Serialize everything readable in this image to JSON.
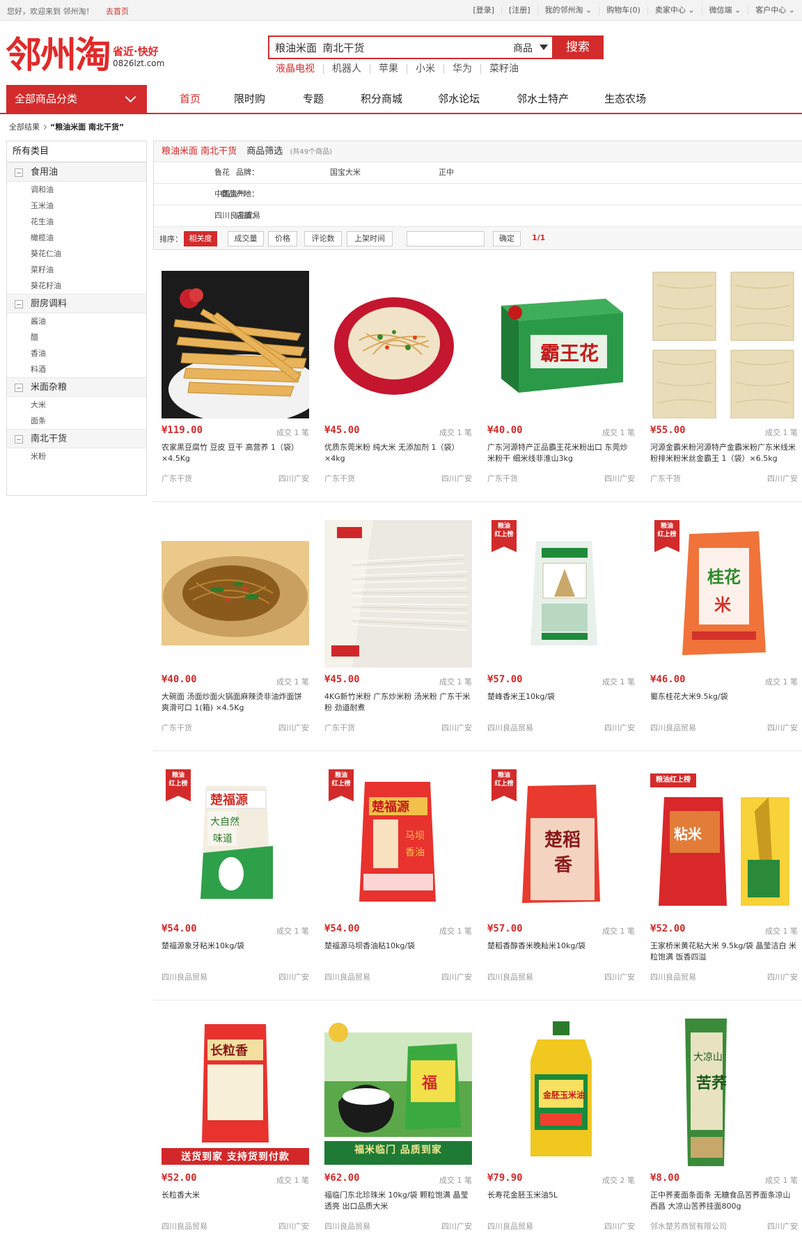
{
  "topbar": {
    "welcome": "您好，欢迎来到 邻州淘！",
    "home_link": "去首页",
    "links": [
      "[登录]",
      "[注册]",
      "我的邻州淘 ⌄",
      "购物车(0)",
      "卖家中心 ⌄",
      "微信端 ⌄",
      "客户中心 ⌄"
    ]
  },
  "logo": {
    "name": "邻州淘",
    "slogan": "省近·快好",
    "domain": "0826lzt.com"
  },
  "search": {
    "value": "粮油米面  南北干货",
    "category": "商品",
    "button": "搜索"
  },
  "hot_words": [
    "液晶电视",
    "机器人",
    "苹果",
    "小米",
    "华为",
    "菜籽油"
  ],
  "nav": {
    "category_button": "全部商品分类",
    "items": [
      "首页",
      "限时购",
      "专题",
      "积分商城",
      "邻水论坛",
      "邻水土特产",
      "生态农场"
    ]
  },
  "breadcrumb": {
    "root": "全部结果",
    "current": "“粮油米面  南北干货”"
  },
  "sidebar": {
    "title": "所有类目",
    "groups": [
      {
        "name": "食用油",
        "items": [
          "调和油",
          "玉米油",
          "花生油",
          "橄榄油",
          "葵花仁油",
          "菜籽油",
          "葵花籽油"
        ]
      },
      {
        "name": "厨房调料",
        "items": [
          "酱油",
          "醋",
          "香油",
          "料酒"
        ]
      },
      {
        "name": "米面杂粮",
        "items": [
          "大米",
          "面条"
        ]
      },
      {
        "name": "南北干货",
        "items": [
          "米粉"
        ]
      }
    ]
  },
  "filter": {
    "keyword": "粮油米面 南北干货",
    "label": "商品筛选",
    "count": "(共49个商品)",
    "brand_key": "品牌：",
    "brands": [
      "鲁花",
      "国宝大米",
      "正中"
    ],
    "origin_key": "商品产地：",
    "origin": "中国贵州",
    "shop_key": "店铺：",
    "shop": "四川良品贸易",
    "sort_label": "排序：",
    "sorts": [
      "相关度",
      "成交量",
      "价格",
      "评论数",
      "上架时间"
    ],
    "confirm": "确定",
    "page": "1/1"
  },
  "colors": {
    "accent": "#d32b2b",
    "muted": "#999999"
  },
  "products": [
    {
      "price": "¥119.00",
      "sold": "成交 1 笔",
      "title": "农家黑豆腐竹 豆皮 豆干 高营养 1（袋）×4.5Kg",
      "shop": "广东干货",
      "loc": "四川广安",
      "img": "yuba",
      "badge": ""
    },
    {
      "price": "¥45.00",
      "sold": "成交 1 笔",
      "title": "优质东莞米粉 纯大米 无添加剂 1（袋）×4kg",
      "shop": "广东干货",
      "loc": "四川广安",
      "img": "noodle-plate",
      "badge": ""
    },
    {
      "price": "¥40.00",
      "sold": "成交 1 笔",
      "title": "广东河源特产正品霸王花米粉出口 东莞炒米粉干 细米线非淮山3kg",
      "shop": "广东干货",
      "loc": "四川广安",
      "img": "green-box",
      "badge": ""
    },
    {
      "price": "¥55.00",
      "sold": "成交 1 笔",
      "title": "河源金霸米粉河源特产金霸米粉广东米线米粉排米粉米丝金霸王 1（袋）×6.5kg",
      "shop": "广东干货",
      "loc": "四川广安",
      "img": "noodle-cakes",
      "badge": ""
    },
    {
      "price": "¥40.00",
      "sold": "成交 1 笔",
      "title": "大碗面 汤面炒面火锅面麻辣烫非油炸面饼 爽滑可口 1(箱) ×4.5Kg",
      "shop": "广东干货",
      "loc": "四川广安",
      "img": "fried-noodle",
      "badge": ""
    },
    {
      "price": "¥45.00",
      "sold": "成交 1 笔",
      "title": "4KG新竹米粉 广东炒米粉 汤米粉 广东干米粉 劲道耐煮",
      "shop": "广东干货",
      "loc": "四川广安",
      "img": "rice-vermicelli",
      "badge": ""
    },
    {
      "price": "¥57.00",
      "sold": "成交 1 笔",
      "title": "楚峰香米王10kg/袋",
      "shop": "四川良品贸易",
      "loc": "四川广安",
      "img": "rice-bag-white",
      "badge": "粮油\n红上榜"
    },
    {
      "price": "¥46.00",
      "sold": "成交 1 笔",
      "title": "蜀东桂花大米9.5kg/袋",
      "shop": "四川良品贸易",
      "loc": "四川广安",
      "img": "rice-bag-orange",
      "badge": "粮油\n红上榜"
    },
    {
      "price": "¥54.00",
      "sold": "成交 1 笔",
      "title": "楚福源象牙粘米10kg/袋",
      "shop": "四川良品贸易",
      "loc": "四川广安",
      "img": "rice-bag-green",
      "badge": "粮油\n红上榜"
    },
    {
      "price": "¥54.00",
      "sold": "成交 1 笔",
      "title": "楚福源马坝香油粘10kg/袋",
      "shop": "四川良品贸易",
      "loc": "四川广安",
      "img": "rice-bag-red",
      "badge": "粮油\n红上榜"
    },
    {
      "price": "¥57.00",
      "sold": "成交 1 笔",
      "title": "楚稻香醇香米晚籼米10kg/袋",
      "shop": "四川良品贸易",
      "loc": "四川广安",
      "img": "rice-bag-pink",
      "badge": "粮油\n红上榜"
    },
    {
      "price": "¥52.00",
      "sold": "成交 1 笔",
      "title": "王家桥米黄花粘大米 9.5kg/袋 晶莹洁白 米粒饱满 饭香四溢",
      "shop": "四川良品贸易",
      "loc": "四川广安",
      "img": "rice-bag-red2",
      "badge2": "粮油红上榜"
    },
    {
      "price": "¥52.00",
      "sold": "成交 1 笔",
      "title": "长粒香大米",
      "shop": "四川良品贸易",
      "loc": "四川广安",
      "img": "rice-bag-long",
      "badge": "",
      "banner": "送货到家  支持货到付款"
    },
    {
      "price": "¥62.00",
      "sold": "成交 1 笔",
      "title": "福临门东北珍珠米 10kg/袋 颗粒饱满 晶莹透亮 出口品质大米",
      "shop": "四川良品贸易",
      "loc": "四川广安",
      "img": "fulinmen",
      "badge": "",
      "banner": "福米临门 品质到家"
    },
    {
      "price": "¥79.90",
      "sold": "成交 2 笔",
      "title": "长寿花金胚玉米油5L",
      "shop": "四川良品贸易",
      "loc": "四川广安",
      "img": "oil-bottle",
      "badge": ""
    },
    {
      "price": "¥8.00",
      "sold": "成交 1 笔",
      "title": "正中荞麦面条面条 无糖食品苦荞面条凉山西昌 大凉山苦荞挂面800g",
      "shop": "邻水楚芳商贸有限公司",
      "loc": "四川广安",
      "img": "buckwheat",
      "badge": ""
    }
  ]
}
